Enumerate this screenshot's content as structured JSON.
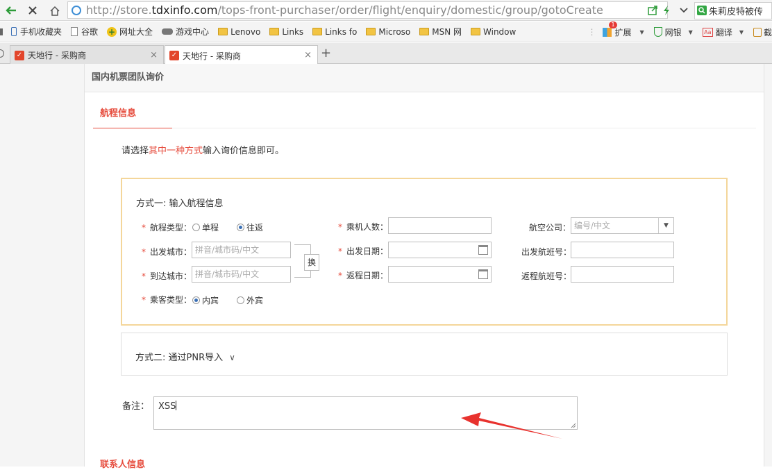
{
  "browser": {
    "url_prefix": "http://store.",
    "url_domain": "tdxinfo.com",
    "url_path": "/tops-front-purchaser/order/flight/enquiry/domestic/group/gotoCreate",
    "search_text": "朱莉皮特被传",
    "bookmarks": [
      "手机收藏夹",
      "谷歌",
      "网址大全",
      "游戏中心",
      "Lenovo",
      "Links",
      "Links fo",
      "Microso",
      "MSN 网",
      "Window"
    ],
    "extensions": {
      "expand": "扩展",
      "expand_badge": "1",
      "bank": "网银",
      "translate": "翻译",
      "more": "截"
    },
    "tabs": [
      {
        "title": "天地行 - 采购商",
        "close": "×"
      },
      {
        "title": "天地行 - 采购商",
        "close": "×"
      }
    ],
    "new_tab": "+"
  },
  "page": {
    "header": "国内机票团队询价",
    "section_tab": "航程信息",
    "instruction_pre": "请选择",
    "instruction_hl": "其中一种方式",
    "instruction_post": "输入询价信息即可。",
    "method1": {
      "title": "方式一: 输入航程信息",
      "req_mark": "*",
      "trip_type_label": "航程类型：",
      "trip_one_way": "单程",
      "trip_round": "往返",
      "passengers_label": "乘机人数：",
      "airline_label": "航空公司：",
      "airline_placeholder": "编号/中文",
      "airline_dropdown": "▼",
      "depart_city_label": "出发城市：",
      "arrive_city_label": "到达城市：",
      "city_placeholder": "拼音/城市码/中文",
      "swap_label": "换",
      "depart_date_label": "出发日期：",
      "return_date_label": "返程日期：",
      "depart_flight_label": "出发航班号：",
      "return_flight_label": "返程航班号：",
      "passenger_type_label": "乘客类型：",
      "passenger_domestic": "内宾",
      "passenger_foreign": "外宾"
    },
    "method2": {
      "title": "方式二: 通过PNR导入",
      "chevron": "∨"
    },
    "notes_label": "备注：",
    "notes_value": "XSS",
    "contact_heading": "联系人信息"
  }
}
